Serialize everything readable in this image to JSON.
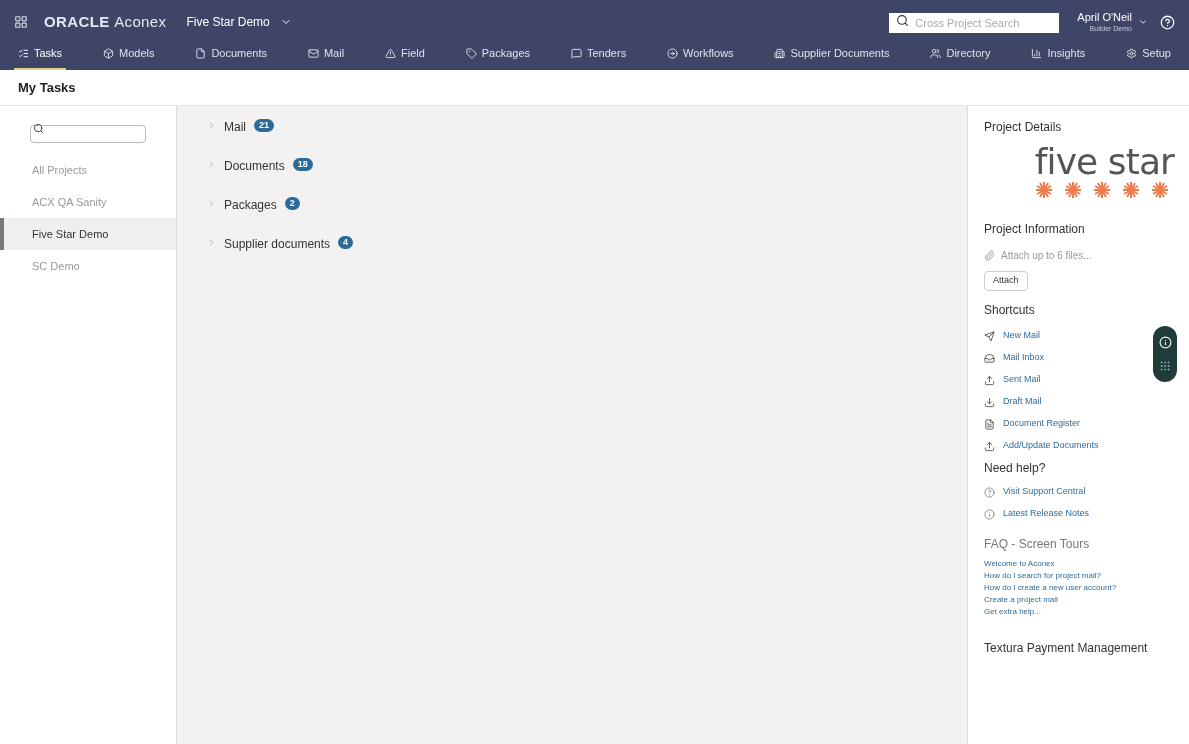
{
  "header": {
    "brand_bold": "ORACLE",
    "brand_light": "Aconex",
    "project": "Five Star Demo",
    "search": {
      "placeholder": "Cross Project Search"
    },
    "user": {
      "name": "April O'Neil",
      "org": "Builder Demo"
    }
  },
  "nav": [
    {
      "label": "Tasks",
      "selected": true
    },
    {
      "label": "Models",
      "selected": false
    },
    {
      "label": "Documents",
      "selected": false
    },
    {
      "label": "Mail",
      "selected": false
    },
    {
      "label": "Field",
      "selected": false
    },
    {
      "label": "Packages",
      "selected": false
    },
    {
      "label": "Tenders",
      "selected": false
    },
    {
      "label": "Workflows",
      "selected": false
    },
    {
      "label": "Supplier Documents",
      "selected": false
    },
    {
      "label": "Directory",
      "selected": false
    },
    {
      "label": "Insights",
      "selected": false
    },
    {
      "label": "Setup",
      "selected": false
    }
  ],
  "page_title": "My Tasks",
  "projects": [
    {
      "label": "All Projects",
      "selected": false
    },
    {
      "label": "ACX QA Sanity",
      "selected": false
    },
    {
      "label": "Five Star Demo",
      "selected": true
    },
    {
      "label": "SC Demo",
      "selected": false
    }
  ],
  "task_groups": [
    {
      "label": "Mail",
      "count": "21",
      "expanded": false
    },
    {
      "label": "Documents",
      "count": "18",
      "expanded": false
    },
    {
      "label": "Packages",
      "count": "2",
      "expanded": false
    },
    {
      "label": "Supplier documents",
      "count": "4",
      "expanded": false
    }
  ],
  "details": {
    "title": "Project Details",
    "logo_text": "five star",
    "info_title": "Project Information",
    "attach_hint": "Attach up to 6 files...",
    "attach_button": "Attach",
    "shortcuts_title": "Shortcuts",
    "shortcuts": [
      "New Mail",
      "Mail Inbox",
      "Sent Mail",
      "Draft Mail",
      "Document Register",
      "Add/Update Documents"
    ],
    "help_title": "Need help?",
    "help": [
      "Visit Support Central",
      "Latest Release Notes"
    ],
    "faq_title": "FAQ - Screen Tours",
    "faq": [
      "Welcome to Aconex",
      "How do I search for project mail?",
      "How do I create a new user account?",
      "Create a project mail",
      "Get extra help..."
    ],
    "textura_title": "Textura Payment Management"
  }
}
